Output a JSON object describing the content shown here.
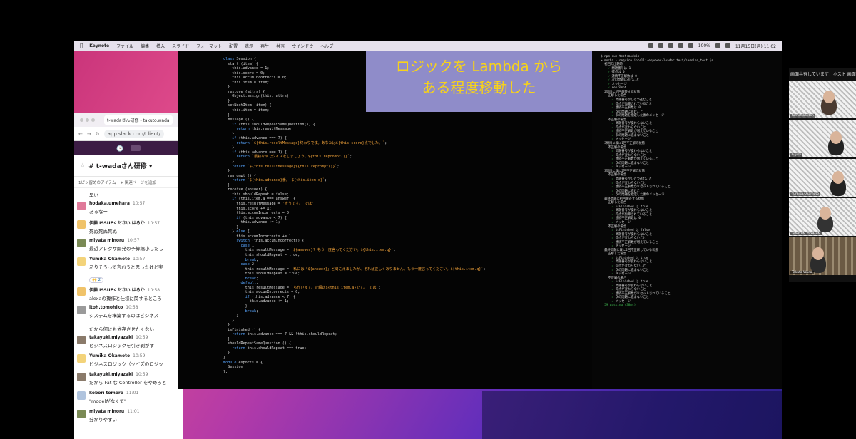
{
  "menubar": {
    "app": "Keynote",
    "items": [
      "ファイル",
      "編集",
      "挿入",
      "スライド",
      "フォーマット",
      "配置",
      "表示",
      "再生",
      "共有",
      "ウインドウ",
      "ヘルプ"
    ],
    "battery": "100% ",
    "datetime": "11月15日(月)  11:02"
  },
  "slack": {
    "tab_title": "t-wadaさん研修 - takuto.wada",
    "url": "app.slack.com/client/",
    "channel_name": "# t-wadaさん研修 ▾",
    "pins": [
      "1ピン留めのアイテム",
      "+ 関連ページを追加"
    ],
    "messages": [
      {
        "type": "cont",
        "text": "早い"
      },
      {
        "type": "msg",
        "user": "hodaka.umehara",
        "time": "10:57",
        "text": "あるなー",
        "avatar": "#e07a9a"
      },
      {
        "type": "msg",
        "user": "伊藤 ISSUEください はるか",
        "time": "10:57",
        "text": "死ぬ死ぬ死ぬ",
        "avatar": "#f0c36a"
      },
      {
        "type": "msg",
        "user": "miyata minoru",
        "time": "10:57",
        "text": "最近アレクサ開発の予算縮小したし",
        "avatar": "#7a8a55"
      },
      {
        "type": "msg",
        "user": "Yumika Okamoto",
        "time": "10:57",
        "text": "ありそうって言おうと思ったけど実",
        "avatar": "#f3d37a",
        "reaction": "🙌 2"
      },
      {
        "type": "msg",
        "user": "伊藤 ISSUEください はるか",
        "time": "10:58",
        "text": "alexaの操作と仕様に関するところ",
        "avatar": "#f0c36a"
      },
      {
        "type": "msg",
        "user": "itoh.tomohiko",
        "time": "10:58",
        "text": "システムを構築するのはビジネス",
        "avatar": "#9a9a9a"
      },
      {
        "type": "cont",
        "text": "だから何にも依存させたくない"
      },
      {
        "type": "msg",
        "user": "takayuki.miyazaki",
        "time": "10:59",
        "text": "ビジネスロジックを引き剥がす",
        "avatar": "#8a7a6a"
      },
      {
        "type": "msg",
        "user": "Yumika Okamoto",
        "time": "10:59",
        "text": "ビジネスロジック（クイズのロジッ",
        "avatar": "#f3d37a"
      },
      {
        "type": "msg",
        "user": "takayuki.miyazaki",
        "time": "10:59",
        "text": "だから Fat な Controller をやめろと",
        "avatar": "#8a7a6a"
      },
      {
        "type": "msg",
        "user": "kobori tomoro",
        "time": "11:01",
        "text": "\"modelがなくて\"",
        "avatar": "#b0c4de"
      },
      {
        "type": "msg",
        "user": "miyata minoru",
        "time": "11:01",
        "text": "分かりやすい",
        "avatar": "#7a8a55"
      }
    ]
  },
  "banner": {
    "line1": "ロジックを Lambda から",
    "line2": "ある程度移動した"
  },
  "code_lines": [
    "class Session {",
    "  start (item) {",
    "    this.advance = 1;",
    "    this.score = 0;",
    "    this.accumIncorrects = 0;",
    "    this.item = item;",
    "  }",
    "  restore (attrs) {",
    "    Object.assign(this, attrs);",
    "  }",
    "  setNextItem (item) {",
    "    this.item = item;",
    "  }",
    "  message () {",
    "    if (this.shouldRepeatSameQuestion()) {",
    "      return this.resultMessage;",
    "    }",
    "    if (this.advance === 7) {",
    "      return `${this.resultMessage}終わりです。あなたは${this.score}点でした。`;",
    "    }",
    "    if (this.advance === 1) {",
    "      return `最初なのでクイズをしましょう。${this.reprompt()}`;",
    "    }",
    "    return `${this.resultMessage}${this.reprompt()}`;",
    "  }",
    "  reprompt () {",
    "    return `${this.advance}番。 ${this.item.q}`;",
    "  }",
    "  receive (answer) {",
    "    this.shouldRepeat = false;",
    "    if (this.item.a === answer) {",
    "      this.resultMessage = 'そうです。 では';",
    "      this.score += 1;",
    "      this.accumIncorrects = 0;",
    "      if (this.advance < 7) {",
    "        this.advance += 1;",
    "      }",
    "    } else {",
    "      this.accumIncorrects += 1;",
    "      switch (this.accumIncorrects) {",
    "        case 1:",
    "          this.resultMessage = `${answer}? もう一度言ってください。${this.item.q}`;",
    "          this.shouldRepeat = true;",
    "          break;",
    "        case 2:",
    "          this.resultMessage = `私には「${answer}」と聞こえましたが、それは正しくありません。もう一度言ってください。${this.item.q}`;",
    "          this.shouldRepeat = true;",
    "          break;",
    "        default:",
    "          this.resultMessage = `ちがいます。正解は${this.item.a}です。 では`;",
    "          this.accumIncorrects = 0;",
    "          if (this.advance < 7) {",
    "            this.advance += 1;",
    "          }",
    "          break;",
    "      }",
    "    }",
    "  }",
    "  isFinished () {",
    "    return this.advance === 7 && !this.shouldRepeat;",
    "  }",
    "  shouldRepeatSameQuestion () {",
    "    return this.shouldRepeat === true;",
    "  }",
    "}",
    "",
    "module.exports = {",
    "  Session",
    "};"
  ],
  "terminal_lines": [
    "$ npm run test:models",
    "",
    "> mocha --require intelli-espower-loader test/session_test.js",
    "",
    "",
    "  初回の出題時",
    "    ✓ 問題番号は 1",
    "    ✓ 得点は 0",
    "    ✓ 連続不正解数は 0",
    "    ✓ 次の問題に進むこと",
    "    ✓ メッセージ",
    "    ✓ reprompt",
    "",
    "  2問目に初回解答する状態",
    "    正解した場合",
    "      ✓ 問題番号がひとつ進むこと",
    "      ✓ 得点が加算されていること",
    "      ✓ 連続不正解数は 0",
    "      ✓ 次の問題に進むこと",
    "      ✓ 次の問題を指定した後のメッセージ",
    "    不正解の場合",
    "      ✓ 問題番号が変わらないこと",
    "      ✓ 得点が変わらないこと",
    "      ✓ 連続不正解数が増えていること",
    "      ✓ 次の問題に進まないこと",
    "      ✓ メッセージ",
    "",
    "  3問目に既に1回不正解の状態",
    "    不正解の場合",
    "      ✓ 問題番号が変わらないこと",
    "      ✓ 得点が変わらないこと",
    "      ✓ 連続不正解数が増えていること",
    "      ✓ 次の問題に進まないこと",
    "      ✓ メッセージ",
    "",
    "  3問目に既に2回不正解の状態",
    "    不正解の場合",
    "      ✓ 問題番号がひとつ進むこと",
    "      ✓ 得点が変わらないこと",
    "      ✓ 連続不正解数がリセットされていること",
    "      ✓ 次の問題に進むこと",
    "      ✓ 次の問題を指定した後のメッセージ",
    "",
    "  最終問題に初回解答する状態",
    "    正解した場合",
    "      ✓ isFinished は true",
    "      ✓ 問題番号が変わらないこと",
    "      ✓ 得点が加算されていること",
    "      ✓ 連続不正解数は 0",
    "      ✓ メッセージ",
    "    不正解の場合",
    "      ✓ isFinished は false",
    "      ✓ 問題番号が変わらないこと",
    "      ✓ 得点が変わらないこと",
    "      ✓ 連続不正解数が増えていること",
    "      ✓ メッセージ",
    "",
    "  最終問題に既に2回不正解している状態",
    "    正解した場合",
    "      ✓ isFinished は true",
    "      ✓ 問題番号が変わらないこと",
    "      ✓ 得点が変わらないこと",
    "      ✓ 次の問題に進まないこと",
    "      ✓ メッセージ",
    "    不正解の場合",
    "      ✓ isFinished は true",
    "      ✓ 問題番号が変わらないこと",
    "      ✓ 得点が変わらないこと",
    "      ✓ 連続不正解数がリセットされていること",
    "      ✓ 次の問題に進まないこと",
    "      ✓ メッセージ",
    "",
    "",
    "  59 passing (38ms)"
  ],
  "zoom": {
    "caption": "画面共有しています：ホスト 画面",
    "participants": [
      "tomohiko.itoh",
      "Fujimi",
      "Yumika.Okamoto",
      "Takayuki Miyazaki",
      "Takuto Wada"
    ]
  }
}
